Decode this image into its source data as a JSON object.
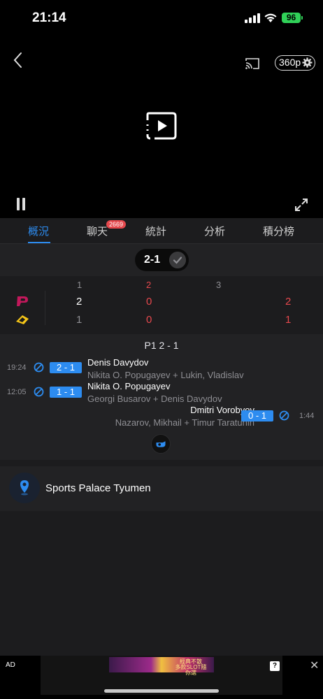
{
  "status": {
    "time": "21:14",
    "battery": "96"
  },
  "player": {
    "quality": "360p"
  },
  "tabs": [
    {
      "label": "概況"
    },
    {
      "label": "聊天"
    },
    {
      "label": "統計"
    },
    {
      "label": "分析"
    },
    {
      "label": "積分榜"
    }
  ],
  "chat_badge": "2669",
  "score": "2-1",
  "periods": {
    "headers": [
      "1",
      "2",
      "3"
    ],
    "teams": [
      {
        "p1": "2",
        "p2": "0",
        "total": "2"
      },
      {
        "p1": "1",
        "p2": "0",
        "total": "1"
      }
    ]
  },
  "events": {
    "period_title": "P1 2 - 1",
    "items": [
      {
        "time": "19:24",
        "score": "2 - 1",
        "scorer": "Denis Davydov",
        "assists": "Nikita O. Popugayev + Lukin, Vladislav"
      },
      {
        "time": "12:05",
        "score": "1 - 1",
        "scorer": "Nikita O. Popugayev",
        "assists": "Georgi Busarov + Denis Davydov"
      },
      {
        "time": "1:44",
        "score": "0 - 1",
        "scorer": "Dmitri Vorobyov",
        "assists": "Nazarov, Mikhail + Timur Taratunin"
      }
    ]
  },
  "venue": "Sports Palace Tyumen",
  "ad": {
    "label": "AD",
    "banner_line1": "經典不散",
    "banner_line2": "多款SLOT隨你選",
    "help": "?",
    "close": "✕"
  }
}
